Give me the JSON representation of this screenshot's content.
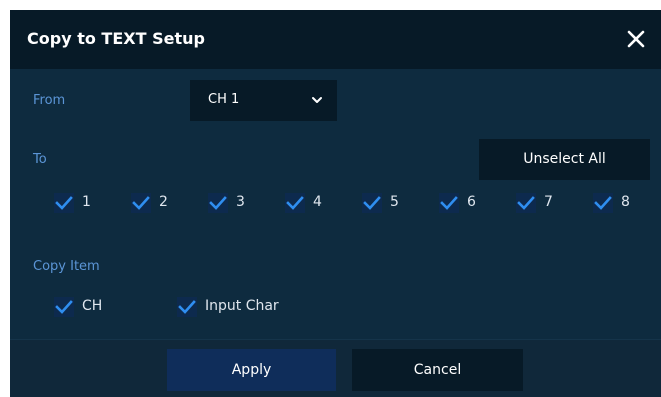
{
  "dialog": {
    "title": "Copy to TEXT Setup",
    "close_icon": "close-icon"
  },
  "from": {
    "label": "From",
    "selected": "CH 1",
    "dropdown_icon": "chevron-down-icon"
  },
  "to": {
    "label": "To",
    "unselect_all_label": "Unselect All",
    "channels": [
      {
        "label": "1",
        "checked": true
      },
      {
        "label": "2",
        "checked": true
      },
      {
        "label": "3",
        "checked": true
      },
      {
        "label": "4",
        "checked": true
      },
      {
        "label": "5",
        "checked": true
      },
      {
        "label": "6",
        "checked": true
      },
      {
        "label": "7",
        "checked": true
      },
      {
        "label": "8",
        "checked": true
      }
    ]
  },
  "copy_item": {
    "label": "Copy Item",
    "items": [
      {
        "label": "CH",
        "checked": true
      },
      {
        "label": "Input Char",
        "checked": true
      }
    ]
  },
  "footer": {
    "apply_label": "Apply",
    "cancel_label": "Cancel"
  },
  "colors": {
    "dialog_bg": "#0e2b3f",
    "titlebar_bg": "#071a27",
    "label_blue": "#5b95d6",
    "checkmark": "#2f8ef0",
    "apply_bg": "#0f2d5a"
  }
}
